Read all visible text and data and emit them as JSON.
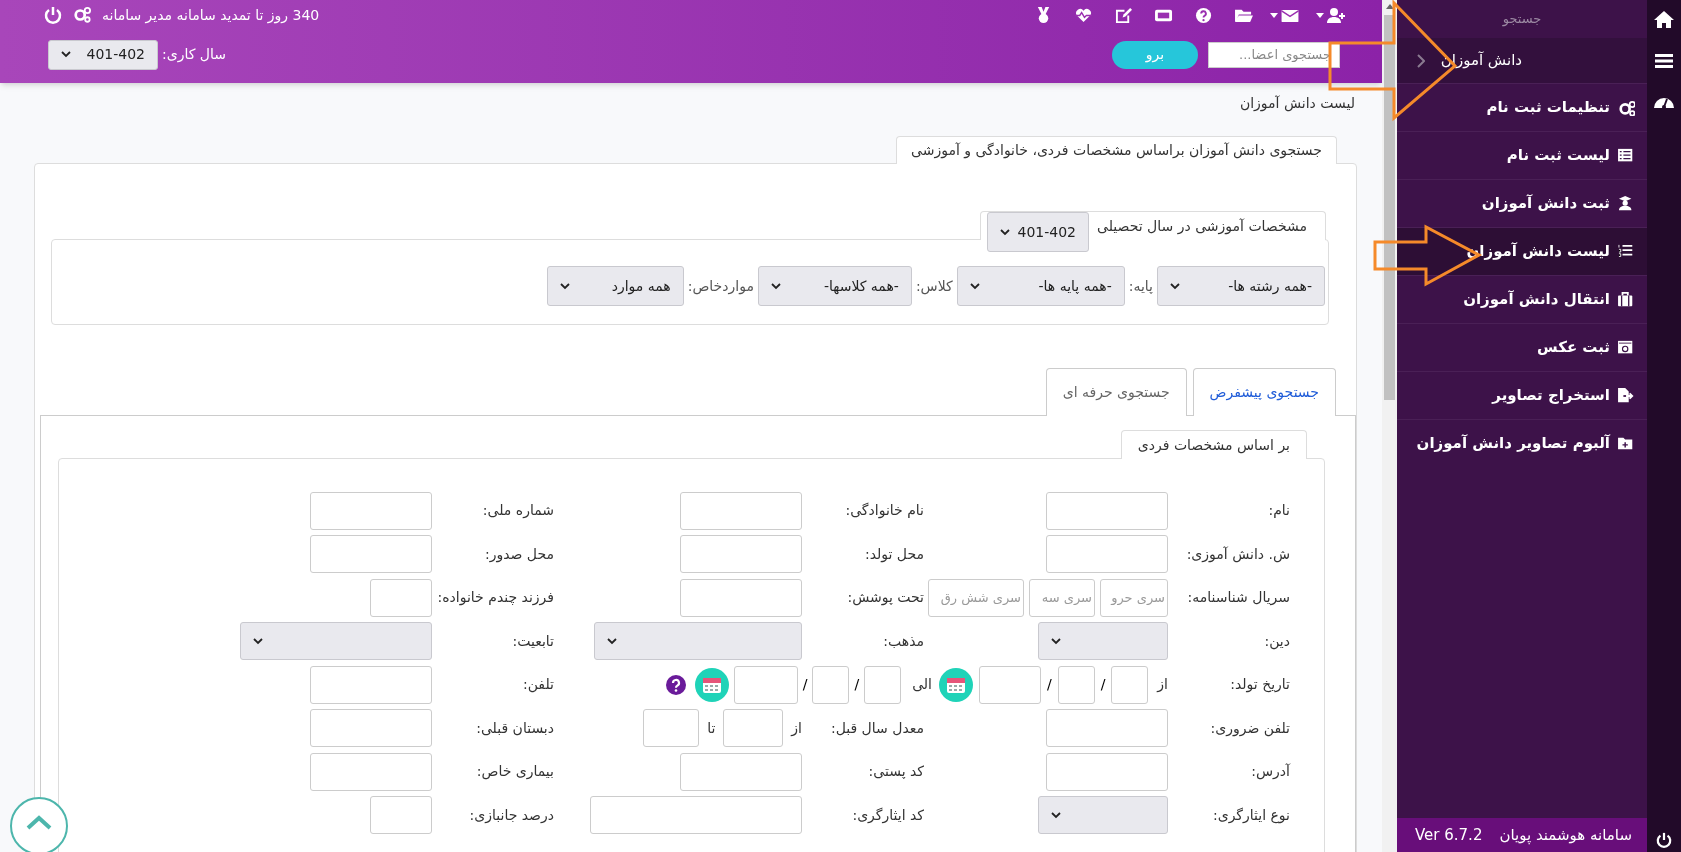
{
  "topbar": {
    "notice": "340 روز تا تمدید سامانه مدیر سامانه",
    "search": {
      "placeholder": "جستجوی اعضا..."
    },
    "go_button": "برو",
    "year_label": "سال کاری:",
    "year_value": "401-402"
  },
  "sidebar": {
    "search_label": "جستجو",
    "section": "دانش آموزان",
    "items": [
      {
        "label": "تنظیمات ثبت نام",
        "selected": false
      },
      {
        "label": "لیست ثبت نام",
        "selected": false
      },
      {
        "label": "ثبت دانش آموزان",
        "selected": false
      },
      {
        "label": "لیست دانش آموزان",
        "selected": true
      },
      {
        "label": "انتقال دانش آموزان",
        "selected": false
      },
      {
        "label": "ثبت عکس",
        "selected": false
      },
      {
        "label": "استخراج تصاویر",
        "selected": false
      },
      {
        "label": "آلبوم تصاویر دانش آموزان",
        "selected": false
      }
    ],
    "footer": {
      "title": "سامانه هوشمند پویان",
      "version": "Ver 6.7.2"
    }
  },
  "breadcrumb": "لیست دانش آموزان",
  "card": {
    "tab": "جستجوی دانش آموزان براساس مشخصات فردی، خانوادگی و آموزشی",
    "education": {
      "legend": "مشخصات آموزشی در سال تحصیلی",
      "year": "401-402",
      "filters": [
        {
          "value": "-همه رشته ها-"
        },
        {
          "label": "پایه:",
          "value": "-همه پایه ها-"
        },
        {
          "label": "کلاس:",
          "value": "-همه کلاسها-"
        },
        {
          "label": "مواردخاص:",
          "value": "همه موارد"
        }
      ]
    },
    "tabs": [
      {
        "label": "جستجوی پیشفرض",
        "selected": true
      },
      {
        "label": "جستجوی حرفه ای",
        "selected": false
      }
    ],
    "personal": {
      "legend": "بر اساس مشخصات فردی",
      "rows": [
        [
          {
            "label": "نام:",
            "kind": "text"
          },
          {
            "label": "نام خانوادگی:",
            "kind": "text"
          },
          {
            "label": "شماره ملی:",
            "kind": "text"
          }
        ],
        [
          {
            "label": "ش. دانش آموزی:",
            "kind": "text"
          },
          {
            "label": "محل تولد:",
            "kind": "text"
          },
          {
            "label": "محل صدور:",
            "kind": "text"
          }
        ],
        [
          {
            "label": "سریال شناسنامه:",
            "kind": "serial",
            "placeholders": [
              "سری حرو",
              "سری سه",
              "سری شش رق"
            ]
          },
          {
            "label": "تحت پوشش:",
            "kind": "text"
          },
          {
            "label": "فرزند چندم خانواده:",
            "kind": "short"
          }
        ],
        [
          {
            "label": "دین:",
            "kind": "select"
          },
          {
            "label": "مذهب:",
            "kind": "select"
          },
          {
            "label": "تابعیت:",
            "kind": "select"
          }
        ],
        [
          {
            "label": "تاریخ تولد:",
            "kind": "date_from",
            "from": "از",
            "separators": [
              "/",
              "/"
            ]
          },
          {
            "kind": "date_to",
            "to": "الی",
            "separators": [
              "/",
              "/"
            ]
          },
          {
            "label": "تلفن:",
            "kind": "text"
          }
        ],
        [
          {
            "label": "تلفن ضروری:",
            "kind": "text"
          },
          {
            "label": "معدل سال قبل:",
            "kind": "range",
            "from": "از",
            "to": "تا"
          },
          {
            "label": "دبستان قبلی:",
            "kind": "text"
          }
        ],
        [
          {
            "label": "آدرس:",
            "kind": "text"
          },
          {
            "label": "کد پستی:",
            "kind": "text"
          },
          {
            "label": "بیماری خاص:",
            "kind": "text"
          }
        ],
        [
          {
            "label": "نوع ایثارگری:",
            "kind": "select"
          },
          {
            "label": "کد ایثارگری:",
            "kind": "wide"
          },
          {
            "label": "درصد جانبازی:",
            "kind": "short"
          }
        ]
      ]
    }
  }
}
